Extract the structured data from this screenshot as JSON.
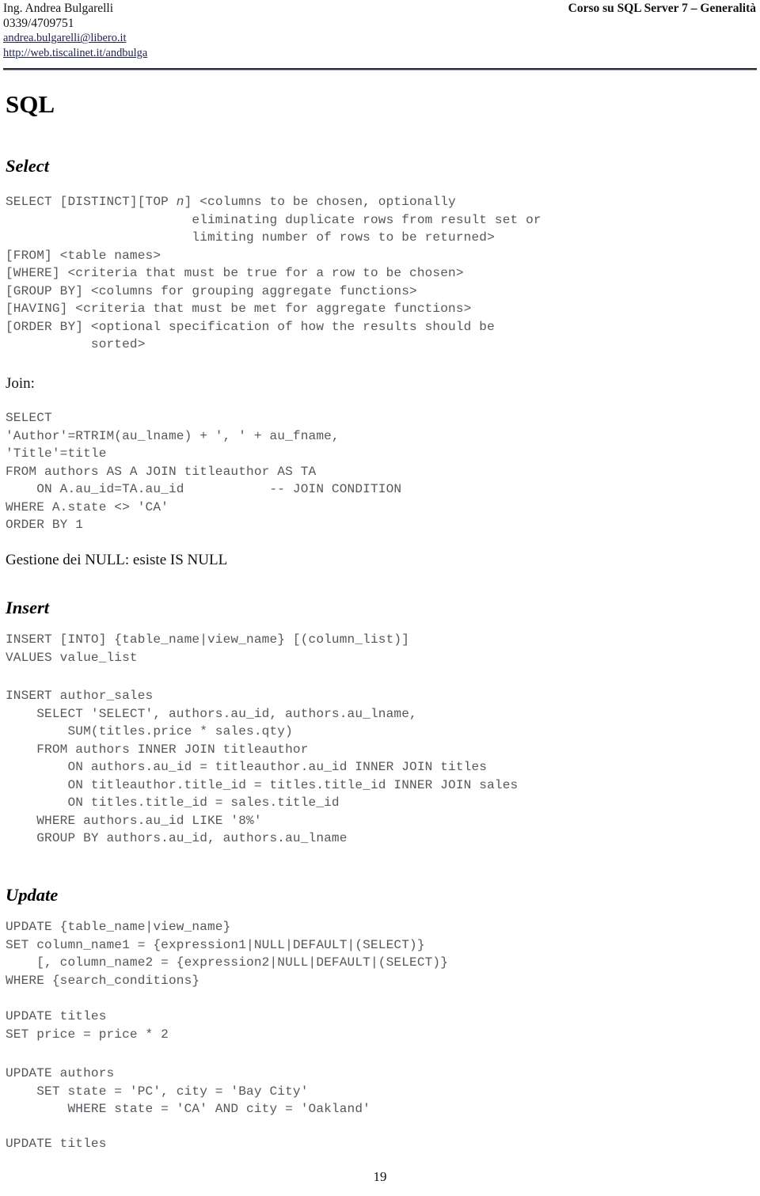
{
  "header": {
    "author_name": "Ing. Andrea Bulgarelli",
    "phone": "0339/4709751",
    "email": "andrea.bulgarelli@libero.it",
    "website": "http://web.tiscalinet.it/andbulga",
    "course_title": "Corso su SQL Server 7 – Generalità"
  },
  "page_title": "SQL",
  "sections": {
    "select": {
      "heading": "Select",
      "syntax": "SELECT [DISTINCT][TOP n] <columns to be chosen, optionally\n                        eliminating duplicate rows from result set or\n                        limiting number of rows to be returned>\n[FROM] <table names>\n[WHERE] <criteria that must be true for a row to be chosen>\n[GROUP BY] <columns for grouping aggregate functions>\n[HAVING] <criteria that must be met for aggregate functions>\n[ORDER BY] <optional specification of how the results should be\n           sorted>",
      "syntax_italic_token": "n",
      "join_label": "Join:",
      "join_example": "SELECT\n'Author'=RTRIM(au_lname) + ', ' + au_fname,\n'Title'=title\nFROM authors AS A JOIN titleauthor AS TA\n    ON A.au_id=TA.au_id           -- JOIN CONDITION\nWHERE A.state <> 'CA'\nORDER BY 1",
      "null_note": "Gestione dei NULL: esiste IS NULL"
    },
    "insert": {
      "heading": "Insert",
      "syntax": "INSERT [INTO] {table_name|view_name} [(column_list)]\nVALUES value_list",
      "example": "INSERT author_sales\n    SELECT 'SELECT', authors.au_id, authors.au_lname,\n        SUM(titles.price * sales.qty)\n    FROM authors INNER JOIN titleauthor\n        ON authors.au_id = titleauthor.au_id INNER JOIN titles\n        ON titleauthor.title_id = titles.title_id INNER JOIN sales\n        ON titles.title_id = sales.title_id\n    WHERE authors.au_id LIKE '8%'\n    GROUP BY authors.au_id, authors.au_lname"
    },
    "update": {
      "heading": "Update",
      "syntax": "UPDATE {table_name|view_name}\nSET column_name1 = {expression1|NULL|DEFAULT|(SELECT)}\n    [, column_name2 = {expression2|NULL|DEFAULT|(SELECT)}\nWHERE {search_conditions}",
      "example_1": "UPDATE titles\nSET price = price * 2",
      "example_2": "UPDATE authors\n    SET state = 'PC', city = 'Bay City'\n        WHERE state = 'CA' AND city = 'Oakland'",
      "example_3": "UPDATE titles"
    }
  },
  "footer": {
    "page_number": "19"
  },
  "colors": {
    "text": "#111111",
    "code": "#56565c",
    "link": "#232350",
    "rule": "#2b2b35"
  }
}
